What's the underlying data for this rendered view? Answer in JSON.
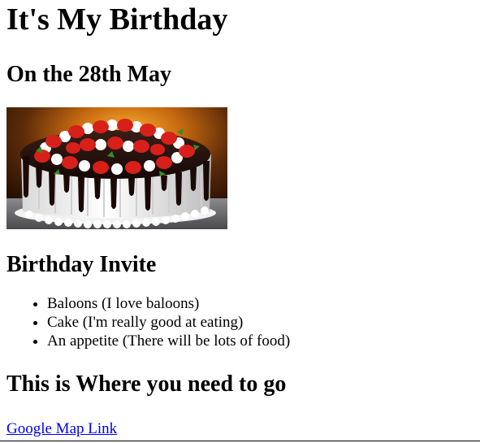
{
  "page": {
    "title": "It's My Birthday",
    "subtitle": "On the 28th May",
    "invite_heading": "Birthday Invite",
    "invite_items": [
      "Baloons (I love baloons)",
      "Cake (I'm really good at eating)",
      "An appetite (There will be lots of food)"
    ],
    "directions_heading": "This is Where you need to go",
    "map_link": "Google Map Link"
  },
  "image": {
    "subject": "chocolate-drip-strawberry-cake"
  },
  "colors": {
    "link": "#0000ee",
    "text": "#000000",
    "background": "#ffffff"
  }
}
